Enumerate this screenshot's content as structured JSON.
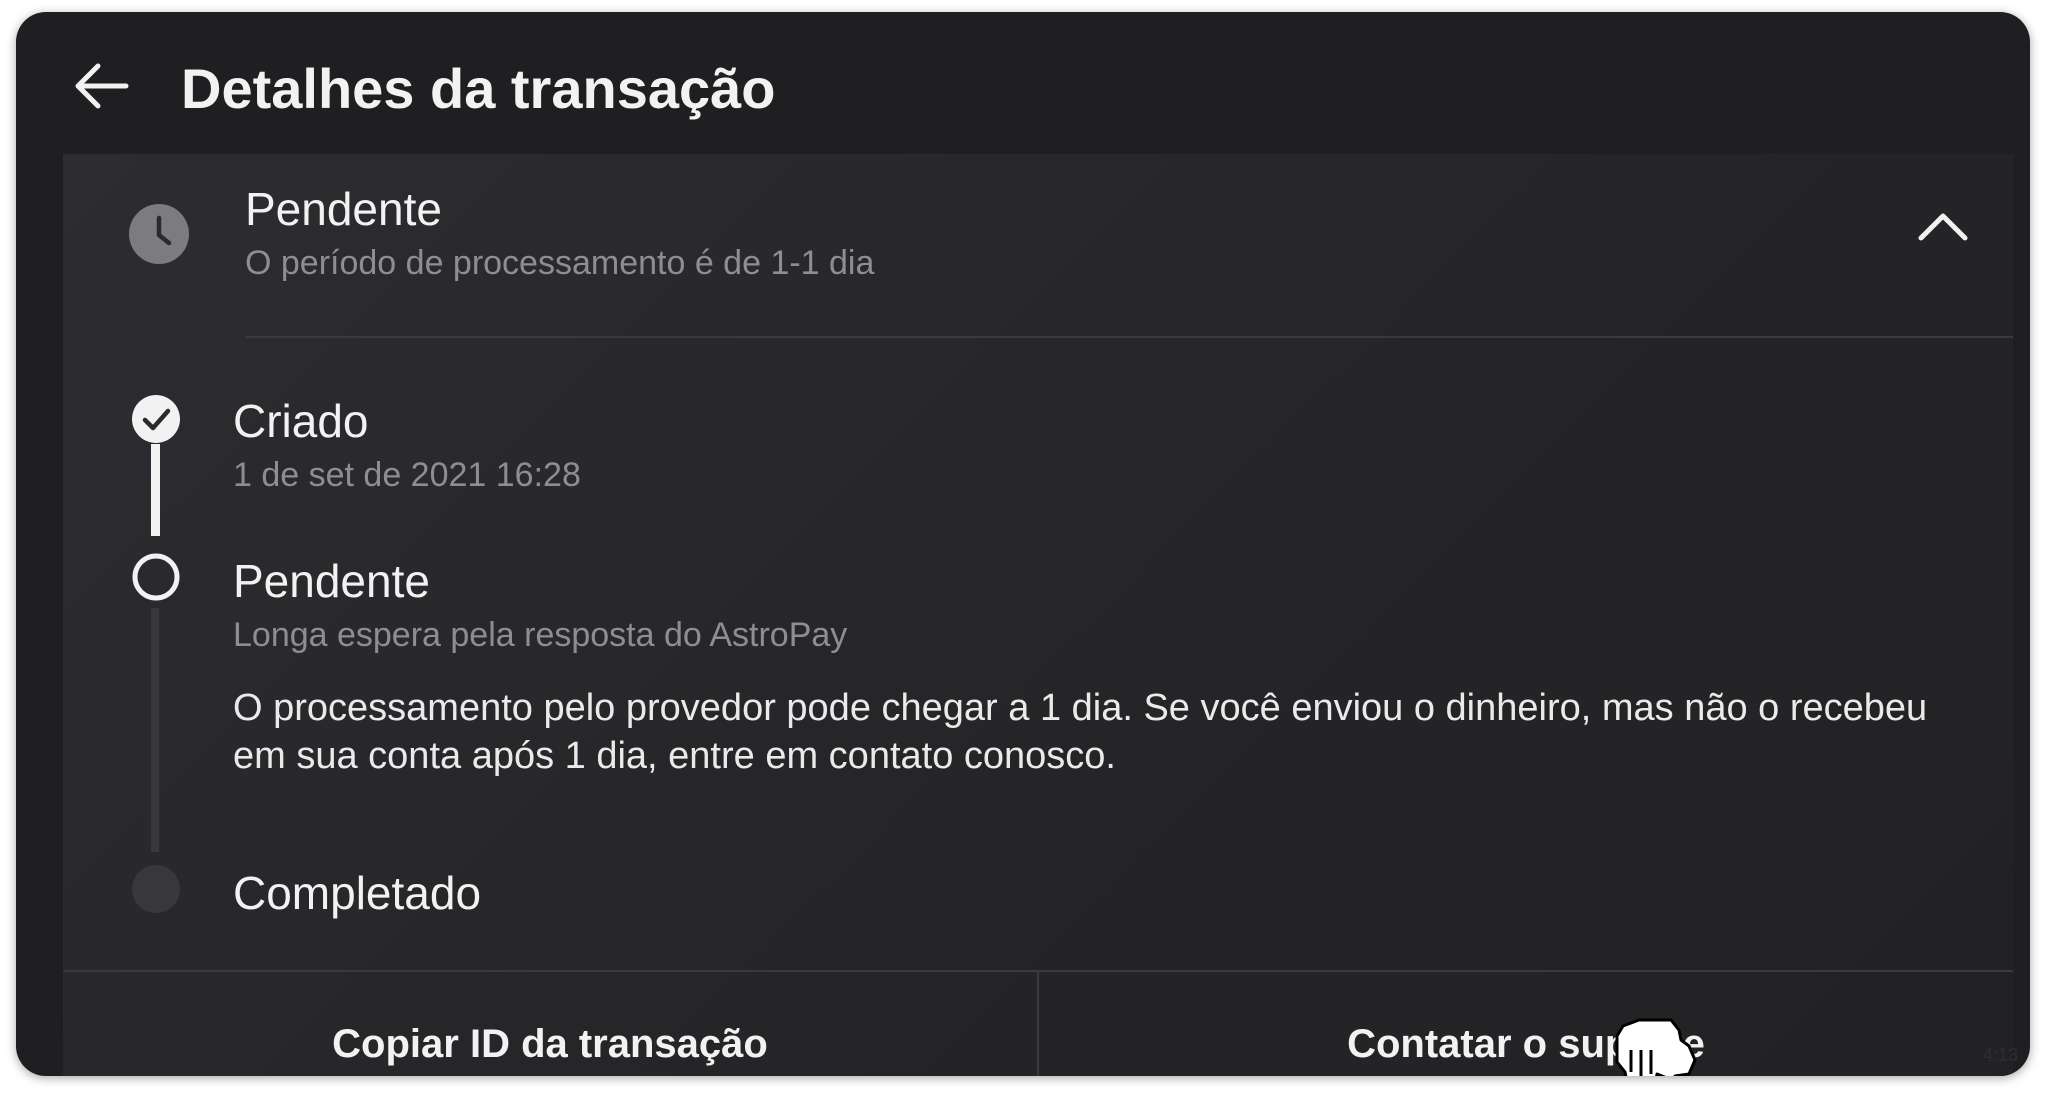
{
  "header": {
    "title": "Detalhes da transação",
    "back_icon": "arrow-left-icon"
  },
  "status": {
    "title": "Pendente",
    "subtitle": "O período de processamento é de 1-1 dia",
    "icon": "clock-icon",
    "toggle_icon": "chevron-up-icon"
  },
  "timeline": {
    "steps": [
      {
        "title": "Criado",
        "subtitle": "1 de set de 2021 16:28",
        "state": "done"
      },
      {
        "title": "Pendente",
        "subtitle": "Longa espera pela resposta do AstroPay",
        "description": "O processamento pelo provedor pode chegar a 1 dia. Se você enviou o dinheiro, mas não o recebeu em sua conta após 1 dia, entre em contato conosco.",
        "state": "current"
      },
      {
        "title": "Completado",
        "state": "upcoming"
      }
    ]
  },
  "actions": {
    "copy_label": "Copiar ID da transação",
    "support_label": "Contatar o suporte"
  },
  "footer": {
    "watermark": "4:13"
  },
  "colors": {
    "background": "#1f1f22",
    "card": "#2a2a2e",
    "text_primary": "#f2f2f2",
    "text_secondary": "#8e8e92",
    "divider": "#3a3a3e"
  }
}
